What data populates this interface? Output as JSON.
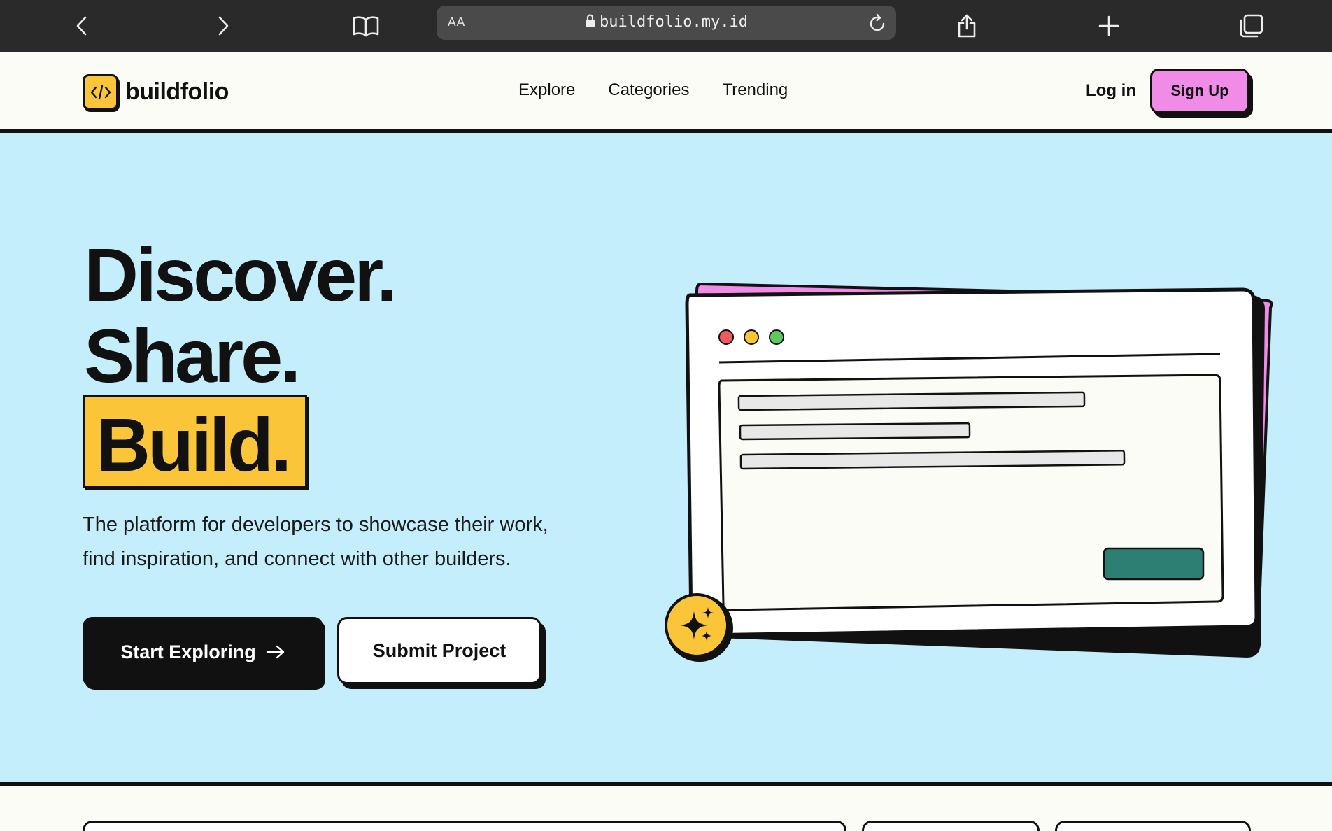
{
  "browser": {
    "url": "buildfolio.my.id",
    "text_size_label": "AA"
  },
  "site": {
    "logo_text": "buildfolio",
    "nav": [
      "Explore",
      "Categories",
      "Trending"
    ],
    "login_label": "Log in",
    "signup_label": "Sign Up"
  },
  "hero": {
    "line1": "Discover.",
    "line2": "Share.",
    "line3": "Build.",
    "tagline_line1": "The platform for developers to showcase their work,",
    "tagline_line2": "find inspiration, and connect with other builders.",
    "primary_cta": "Start Exploring",
    "secondary_cta": "Submit Project"
  },
  "colors": {
    "hero_bg": "#c5eefd",
    "accent_yellow": "#fbc53a",
    "accent_pink": "#f08ce8",
    "accent_teal": "#2e7f73",
    "ink": "#111111"
  },
  "icons": {
    "back": "chevron-left-icon",
    "forward": "chevron-right-icon",
    "reader": "book-icon",
    "lock": "lock-icon",
    "reload": "reload-icon",
    "share": "share-icon",
    "new_tab": "plus-icon",
    "tabs": "tabs-icon",
    "logo": "code-brackets-icon",
    "cta_arrow": "arrow-right-icon",
    "sparkle": "sparkle-icon"
  }
}
